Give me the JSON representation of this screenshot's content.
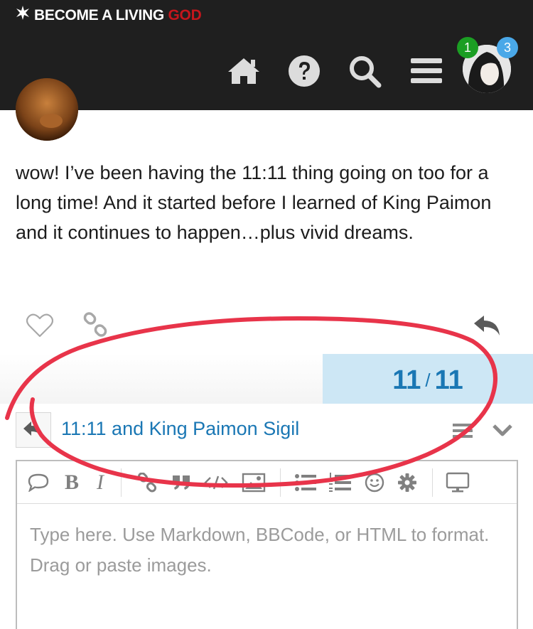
{
  "header": {
    "logo_main": "BECOME A LIVING ",
    "logo_accent": "GOD",
    "icons": [
      "home-icon",
      "help-icon",
      "search-icon",
      "hamburger-menu-icon"
    ],
    "notifications": {
      "unread": "1",
      "private_messages": "3"
    }
  },
  "post": {
    "body": "wow! I’ve been having the 11:11 thing going on too for a long time! And it started before I learned of King Paimon and it continues to happen…plus vivid dreams."
  },
  "progress": {
    "current": "11",
    "separator": "/",
    "total": "11",
    "fraction": 1.0
  },
  "composer": {
    "reply_title": "11:11 and King Paimon Sigil",
    "placeholder": "Type here. Use Markdown, BBCode, or HTML to format. Drag or paste images.",
    "toolbar": {
      "bold": "B",
      "italic": "I"
    }
  },
  "colors": {
    "header_bg": "#1f1f1f",
    "accent_red": "#c4161c",
    "link_blue": "#1a77b4",
    "progress_bg": "#cde7f5",
    "annotation_red": "#e8344a"
  }
}
